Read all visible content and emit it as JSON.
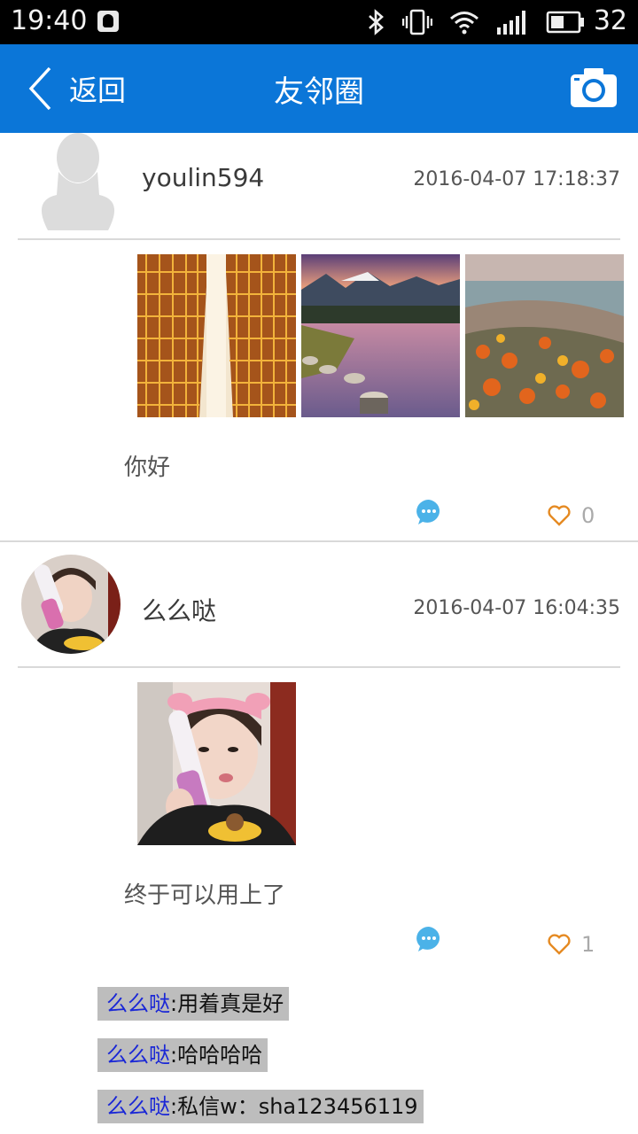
{
  "status_bar": {
    "time": "19:40",
    "battery_level": "32",
    "icons": [
      "qq-notification-icon",
      "bluetooth-icon",
      "vibrate-icon",
      "wifi-icon",
      "signal-icon",
      "battery-icon"
    ]
  },
  "header": {
    "back_label": "返回",
    "title": "友邻圈",
    "camera_icon": "camera-icon",
    "bg_color": "#0b76d8"
  },
  "posts": [
    {
      "username": "youlin594",
      "time": "2016-04-07 17:18:37",
      "text": "你好",
      "likes": "0",
      "images": [
        "city-buildings-photo",
        "mountain-lake-photo",
        "autumn-landscape-photo"
      ]
    },
    {
      "username": "么么哒",
      "time": "2016-04-07 16:04:35",
      "text": "终于可以用上了",
      "likes": "1",
      "images": [
        "selfie-photo"
      ],
      "replies": [
        {
          "user": "么么哒",
          "text": ":用着真是好"
        },
        {
          "user": "么么哒",
          "text": ":哈哈哈哈"
        },
        {
          "user": "么么哒",
          "text": ":私信w：sha123456119"
        }
      ]
    }
  ]
}
